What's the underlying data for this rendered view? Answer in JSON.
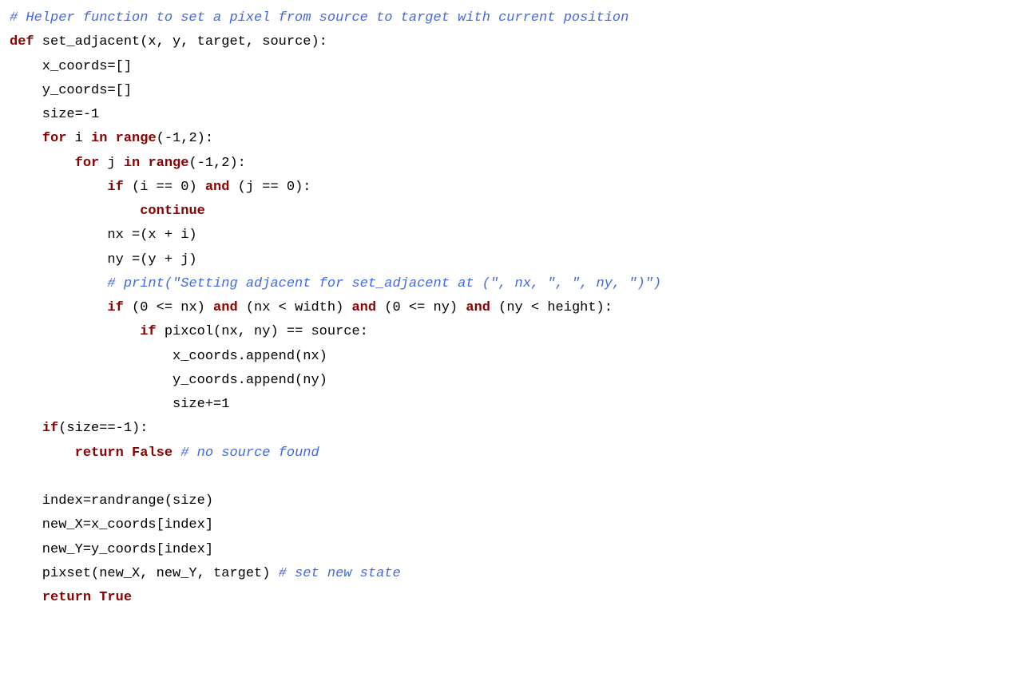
{
  "lines": {
    "0": {
      "a": "# Helper function to set a pixel from source to target with current position"
    },
    "1": {
      "a": "def",
      "b": " set_adjacent(x, y, target, source):"
    },
    "2": {
      "a": "    x_coords=[]"
    },
    "3": {
      "a": "    y_coords=[]"
    },
    "4": {
      "a": "    size=-1"
    },
    "5": {
      "a": "    ",
      "b": "for",
      "c": " i ",
      "d": "in",
      "e": " ",
      "f": "range",
      "g": "(-1,2):"
    },
    "6": {
      "a": "        ",
      "b": "for",
      "c": " j ",
      "d": "in",
      "e": " ",
      "f": "range",
      "g": "(-1,2):"
    },
    "7": {
      "a": "            ",
      "b": "if",
      "c": " (i == 0) ",
      "d": "and",
      "e": " (j == 0):"
    },
    "8": {
      "a": "                ",
      "b": "continue"
    },
    "9": {
      "a": "            nx =(x + i)"
    },
    "10": {
      "a": "            ny =(y + j)"
    },
    "11": {
      "a": "            ",
      "b": "# print(\"Setting adjacent for set_adjacent at (\", nx, \", \", ny, \")\")"
    },
    "12": {
      "a": "            ",
      "b": "if",
      "c": " (0 <= nx) ",
      "d": "and",
      "e": " (nx < width) ",
      "f": "and",
      "g": " (0 <= ny) ",
      "h": "and",
      "i": " (ny < height):"
    },
    "13": {
      "a": "                ",
      "b": "if",
      "c": " pixcol(nx, ny) == source:"
    },
    "14": {
      "a": "                    x_coords.append(nx)"
    },
    "15": {
      "a": "                    y_coords.append(ny)"
    },
    "16": {
      "a": "                    size+=1"
    },
    "17": {
      "a": "    ",
      "b": "if",
      "c": "(size==-1):"
    },
    "18": {
      "a": "        ",
      "b": "return",
      "c": " ",
      "d": "False",
      "e": " ",
      "f": "# no source found"
    },
    "19": {
      "a": " "
    },
    "20": {
      "a": "    index=randrange(size)"
    },
    "21": {
      "a": "    new_X=x_coords[index]"
    },
    "22": {
      "a": "    new_Y=y_coords[index]"
    },
    "23": {
      "a": "    pixset(new_X, new_Y, target) ",
      "b": "# set new state"
    },
    "24": {
      "a": "    ",
      "b": "return",
      "c": " ",
      "d": "True"
    }
  }
}
